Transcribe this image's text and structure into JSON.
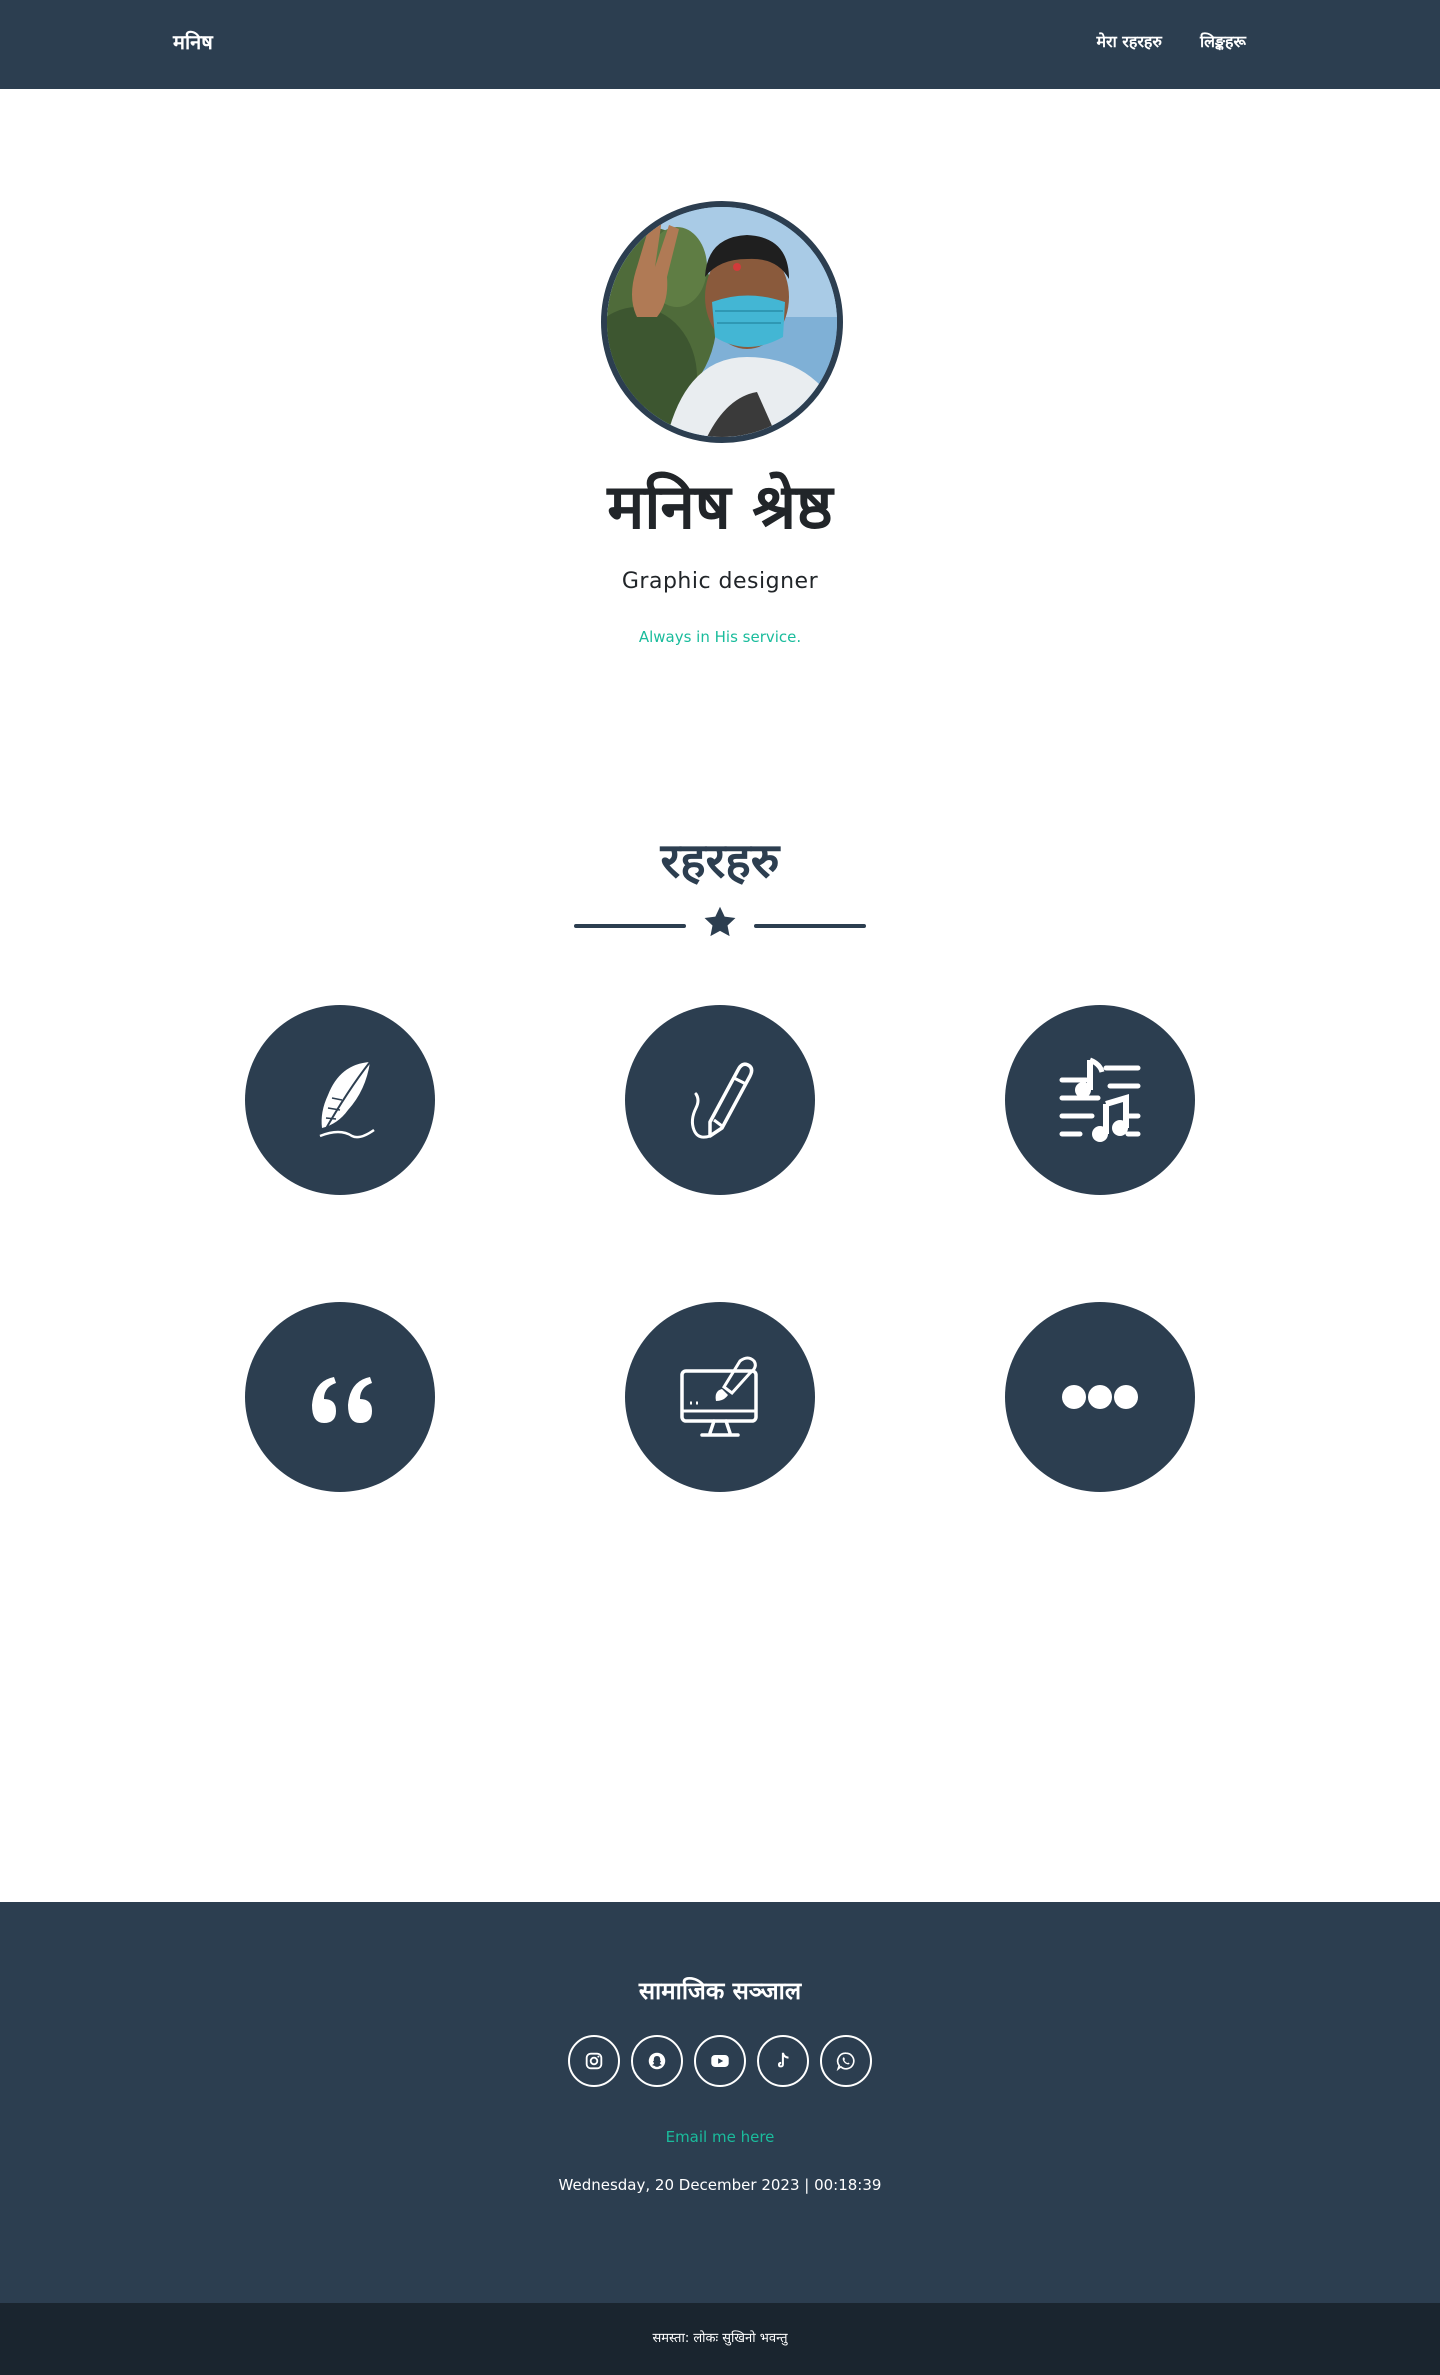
{
  "navbar": {
    "brand": "मनिष",
    "links": [
      {
        "label": "मेरा रहरहरु"
      },
      {
        "label": "लिङ्कहरू"
      }
    ]
  },
  "hero": {
    "name": "मनिष श्रेष्ठ",
    "title": "Graphic designer",
    "tagline": "Always in His service."
  },
  "hobbies": {
    "heading": "रहरहरु",
    "items": [
      {
        "icon": "feather-icon"
      },
      {
        "icon": "pencil-icon"
      },
      {
        "icon": "music-icon"
      },
      {
        "icon": "quote-icon"
      },
      {
        "icon": "computer-paint-icon"
      },
      {
        "icon": "ellipsis-icon"
      }
    ]
  },
  "footer": {
    "heading": "सामाजिक सञ्जाल",
    "social": [
      {
        "icon": "instagram-icon"
      },
      {
        "icon": "snapchat-icon"
      },
      {
        "icon": "youtube-icon"
      },
      {
        "icon": "tiktok-icon"
      },
      {
        "icon": "whatsapp-icon"
      }
    ],
    "email_label": "Email me here",
    "datetime": "Wednesday, 20 December 2023 | 00:18:39"
  },
  "copyright": "समस्ता: लोकः सुखिनो भवन्तु",
  "colors": {
    "primary": "#2c3e50",
    "accent": "#1abc9c",
    "dark": "#1a252f"
  }
}
